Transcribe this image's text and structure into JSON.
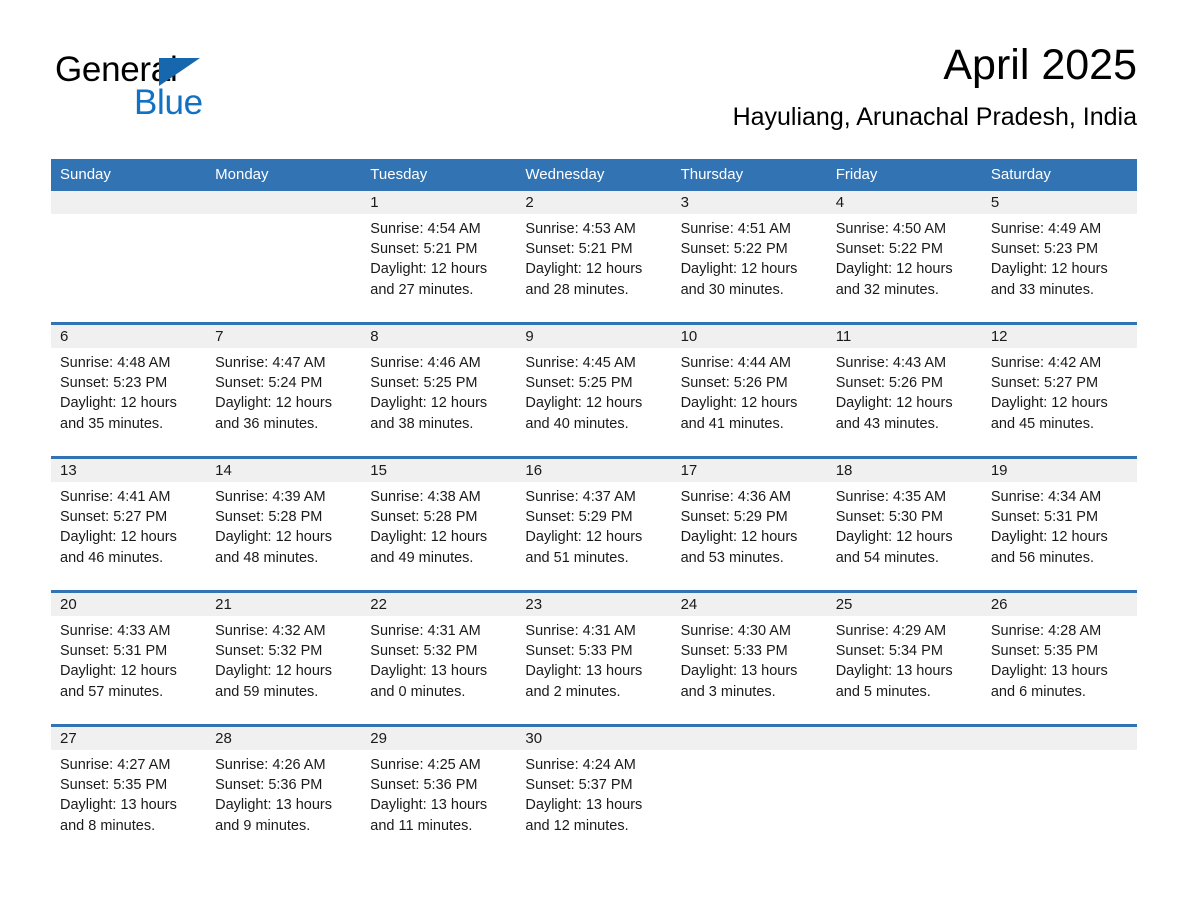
{
  "brand": {
    "logo_text_line1": "General",
    "logo_text_line2": "Blue",
    "logo_black": "#000000",
    "logo_blue": "#1371c3",
    "triangle_icon": "triangle-icon"
  },
  "header": {
    "title": "April 2025",
    "subtitle": "Hayuliang, Arunachal Pradesh, India"
  },
  "theme": {
    "header_blue": "#3273b4",
    "band_gray": "#f0f0f0",
    "text": "#1a1a1a"
  },
  "calendar": {
    "weekday_headers": [
      "Sunday",
      "Monday",
      "Tuesday",
      "Wednesday",
      "Thursday",
      "Friday",
      "Saturday"
    ],
    "weeks": [
      [
        {
          "day": "",
          "lines": []
        },
        {
          "day": "",
          "lines": []
        },
        {
          "day": "1",
          "lines": [
            "Sunrise: 4:54 AM",
            "Sunset: 5:21 PM",
            "Daylight: 12 hours",
            "and 27 minutes."
          ]
        },
        {
          "day": "2",
          "lines": [
            "Sunrise: 4:53 AM",
            "Sunset: 5:21 PM",
            "Daylight: 12 hours",
            "and 28 minutes."
          ]
        },
        {
          "day": "3",
          "lines": [
            "Sunrise: 4:51 AM",
            "Sunset: 5:22 PM",
            "Daylight: 12 hours",
            "and 30 minutes."
          ]
        },
        {
          "day": "4",
          "lines": [
            "Sunrise: 4:50 AM",
            "Sunset: 5:22 PM",
            "Daylight: 12 hours",
            "and 32 minutes."
          ]
        },
        {
          "day": "5",
          "lines": [
            "Sunrise: 4:49 AM",
            "Sunset: 5:23 PM",
            "Daylight: 12 hours",
            "and 33 minutes."
          ]
        }
      ],
      [
        {
          "day": "6",
          "lines": [
            "Sunrise: 4:48 AM",
            "Sunset: 5:23 PM",
            "Daylight: 12 hours",
            "and 35 minutes."
          ]
        },
        {
          "day": "7",
          "lines": [
            "Sunrise: 4:47 AM",
            "Sunset: 5:24 PM",
            "Daylight: 12 hours",
            "and 36 minutes."
          ]
        },
        {
          "day": "8",
          "lines": [
            "Sunrise: 4:46 AM",
            "Sunset: 5:25 PM",
            "Daylight: 12 hours",
            "and 38 minutes."
          ]
        },
        {
          "day": "9",
          "lines": [
            "Sunrise: 4:45 AM",
            "Sunset: 5:25 PM",
            "Daylight: 12 hours",
            "and 40 minutes."
          ]
        },
        {
          "day": "10",
          "lines": [
            "Sunrise: 4:44 AM",
            "Sunset: 5:26 PM",
            "Daylight: 12 hours",
            "and 41 minutes."
          ]
        },
        {
          "day": "11",
          "lines": [
            "Sunrise: 4:43 AM",
            "Sunset: 5:26 PM",
            "Daylight: 12 hours",
            "and 43 minutes."
          ]
        },
        {
          "day": "12",
          "lines": [
            "Sunrise: 4:42 AM",
            "Sunset: 5:27 PM",
            "Daylight: 12 hours",
            "and 45 minutes."
          ]
        }
      ],
      [
        {
          "day": "13",
          "lines": [
            "Sunrise: 4:41 AM",
            "Sunset: 5:27 PM",
            "Daylight: 12 hours",
            "and 46 minutes."
          ]
        },
        {
          "day": "14",
          "lines": [
            "Sunrise: 4:39 AM",
            "Sunset: 5:28 PM",
            "Daylight: 12 hours",
            "and 48 minutes."
          ]
        },
        {
          "day": "15",
          "lines": [
            "Sunrise: 4:38 AM",
            "Sunset: 5:28 PM",
            "Daylight: 12 hours",
            "and 49 minutes."
          ]
        },
        {
          "day": "16",
          "lines": [
            "Sunrise: 4:37 AM",
            "Sunset: 5:29 PM",
            "Daylight: 12 hours",
            "and 51 minutes."
          ]
        },
        {
          "day": "17",
          "lines": [
            "Sunrise: 4:36 AM",
            "Sunset: 5:29 PM",
            "Daylight: 12 hours",
            "and 53 minutes."
          ]
        },
        {
          "day": "18",
          "lines": [
            "Sunrise: 4:35 AM",
            "Sunset: 5:30 PM",
            "Daylight: 12 hours",
            "and 54 minutes."
          ]
        },
        {
          "day": "19",
          "lines": [
            "Sunrise: 4:34 AM",
            "Sunset: 5:31 PM",
            "Daylight: 12 hours",
            "and 56 minutes."
          ]
        }
      ],
      [
        {
          "day": "20",
          "lines": [
            "Sunrise: 4:33 AM",
            "Sunset: 5:31 PM",
            "Daylight: 12 hours",
            "and 57 minutes."
          ]
        },
        {
          "day": "21",
          "lines": [
            "Sunrise: 4:32 AM",
            "Sunset: 5:32 PM",
            "Daylight: 12 hours",
            "and 59 minutes."
          ]
        },
        {
          "day": "22",
          "lines": [
            "Sunrise: 4:31 AM",
            "Sunset: 5:32 PM",
            "Daylight: 13 hours",
            "and 0 minutes."
          ]
        },
        {
          "day": "23",
          "lines": [
            "Sunrise: 4:31 AM",
            "Sunset: 5:33 PM",
            "Daylight: 13 hours",
            "and 2 minutes."
          ]
        },
        {
          "day": "24",
          "lines": [
            "Sunrise: 4:30 AM",
            "Sunset: 5:33 PM",
            "Daylight: 13 hours",
            "and 3 minutes."
          ]
        },
        {
          "day": "25",
          "lines": [
            "Sunrise: 4:29 AM",
            "Sunset: 5:34 PM",
            "Daylight: 13 hours",
            "and 5 minutes."
          ]
        },
        {
          "day": "26",
          "lines": [
            "Sunrise: 4:28 AM",
            "Sunset: 5:35 PM",
            "Daylight: 13 hours",
            "and 6 minutes."
          ]
        }
      ],
      [
        {
          "day": "27",
          "lines": [
            "Sunrise: 4:27 AM",
            "Sunset: 5:35 PM",
            "Daylight: 13 hours",
            "and 8 minutes."
          ]
        },
        {
          "day": "28",
          "lines": [
            "Sunrise: 4:26 AM",
            "Sunset: 5:36 PM",
            "Daylight: 13 hours",
            "and 9 minutes."
          ]
        },
        {
          "day": "29",
          "lines": [
            "Sunrise: 4:25 AM",
            "Sunset: 5:36 PM",
            "Daylight: 13 hours",
            "and 11 minutes."
          ]
        },
        {
          "day": "30",
          "lines": [
            "Sunrise: 4:24 AM",
            "Sunset: 5:37 PM",
            "Daylight: 13 hours",
            "and 12 minutes."
          ]
        },
        {
          "day": "",
          "lines": []
        },
        {
          "day": "",
          "lines": []
        },
        {
          "day": "",
          "lines": []
        }
      ]
    ]
  }
}
